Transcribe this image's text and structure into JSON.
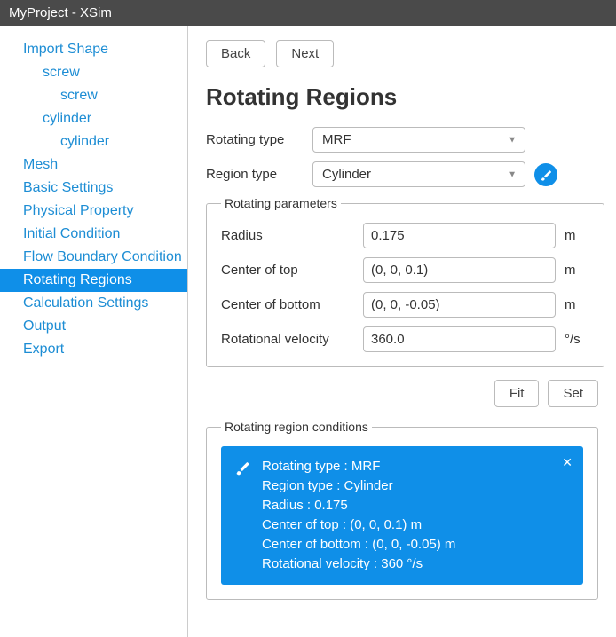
{
  "titlebar": "MyProject - XSim",
  "sidebar": {
    "items": [
      {
        "label": "Import Shape",
        "indent": 0
      },
      {
        "label": "screw",
        "indent": 1
      },
      {
        "label": "screw",
        "indent": 2
      },
      {
        "label": "cylinder",
        "indent": 1
      },
      {
        "label": "cylinder",
        "indent": 2
      },
      {
        "label": "Mesh",
        "indent": 0
      },
      {
        "label": "Basic Settings",
        "indent": 0
      },
      {
        "label": "Physical Property",
        "indent": 0
      },
      {
        "label": "Initial Condition",
        "indent": 0
      },
      {
        "label": "Flow Boundary Condition",
        "indent": 0
      },
      {
        "label": "Rotating Regions",
        "indent": 0,
        "selected": true
      },
      {
        "label": "Calculation Settings",
        "indent": 0
      },
      {
        "label": "Output",
        "indent": 0
      },
      {
        "label": "Export",
        "indent": 0
      }
    ]
  },
  "nav": {
    "back": "Back",
    "next": "Next"
  },
  "heading": "Rotating Regions",
  "rotating_type": {
    "label": "Rotating type",
    "value": "MRF"
  },
  "region_type": {
    "label": "Region type",
    "value": "Cylinder"
  },
  "params": {
    "legend": "Rotating parameters",
    "radius": {
      "label": "Radius",
      "value": "0.175",
      "unit": "m"
    },
    "center_top": {
      "label": "Center of top",
      "value": "(0, 0, 0.1)",
      "unit": "m"
    },
    "center_bottom": {
      "label": "Center of bottom",
      "value": "(0, 0, -0.05)",
      "unit": "m"
    },
    "rot_velocity": {
      "label": "Rotational velocity",
      "value": "360.0",
      "unit": "°/s"
    }
  },
  "actions": {
    "fit": "Fit",
    "set": "Set"
  },
  "conditions": {
    "legend": "Rotating region conditions",
    "lines": {
      "l1": "Rotating type : MRF",
      "l2": "Region type : Cylinder",
      "l3": "Radius : 0.175",
      "l4": "Center of top : (0, 0, 0.1) m",
      "l5": "Center of bottom : (0, 0, -0.05) m",
      "l6": "Rotational velocity : 360 °/s"
    }
  }
}
